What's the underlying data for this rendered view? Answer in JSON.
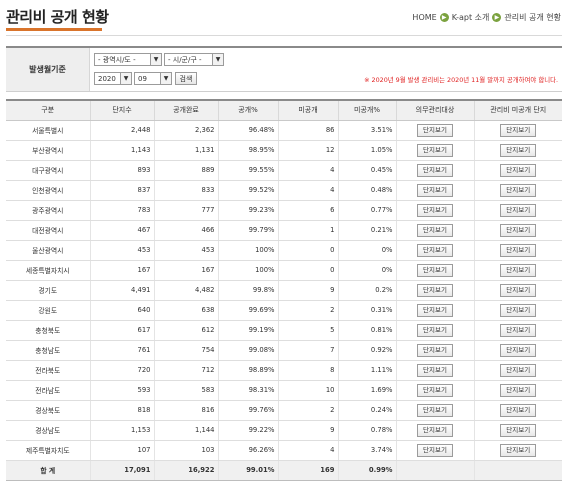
{
  "page": {
    "title": "관리비 공개 현황",
    "breadcrumb": [
      "HOME",
      "K-apt 소개",
      "관리비 공개 현황"
    ]
  },
  "filter": {
    "label": "발생월기준",
    "region_select": "- 광역시/도 -",
    "district_select": "- 시/군/구 -",
    "year_select": "2020",
    "month_select": "09",
    "search_button": "검색",
    "notice": "※ 2020년 9월 발생 관리비는 2020년 11월 말까지 공개하여야 합니다."
  },
  "table": {
    "headers": [
      "구분",
      "단지수",
      "공개완료",
      "공개%",
      "미공개",
      "미공개%",
      "의무관리대상",
      "관리비 미공개 단지"
    ],
    "button_label": "단지보기",
    "rows": [
      {
        "region": "서울특별시",
        "complexes": "2,448",
        "disclosed": "2,362",
        "disclosed_pct": "96.48%",
        "undisclosed": "86",
        "undisclosed_pct": "3.51%"
      },
      {
        "region": "부산광역시",
        "complexes": "1,143",
        "disclosed": "1,131",
        "disclosed_pct": "98.95%",
        "undisclosed": "12",
        "undisclosed_pct": "1.05%"
      },
      {
        "region": "대구광역시",
        "complexes": "893",
        "disclosed": "889",
        "disclosed_pct": "99.55%",
        "undisclosed": "4",
        "undisclosed_pct": "0.45%"
      },
      {
        "region": "인천광역시",
        "complexes": "837",
        "disclosed": "833",
        "disclosed_pct": "99.52%",
        "undisclosed": "4",
        "undisclosed_pct": "0.48%"
      },
      {
        "region": "광주광역시",
        "complexes": "783",
        "disclosed": "777",
        "disclosed_pct": "99.23%",
        "undisclosed": "6",
        "undisclosed_pct": "0.77%"
      },
      {
        "region": "대전광역시",
        "complexes": "467",
        "disclosed": "466",
        "disclosed_pct": "99.79%",
        "undisclosed": "1",
        "undisclosed_pct": "0.21%"
      },
      {
        "region": "울산광역시",
        "complexes": "453",
        "disclosed": "453",
        "disclosed_pct": "100%",
        "undisclosed": "0",
        "undisclosed_pct": "0%"
      },
      {
        "region": "세종특별자치시",
        "complexes": "167",
        "disclosed": "167",
        "disclosed_pct": "100%",
        "undisclosed": "0",
        "undisclosed_pct": "0%"
      },
      {
        "region": "경기도",
        "complexes": "4,491",
        "disclosed": "4,482",
        "disclosed_pct": "99.8%",
        "undisclosed": "9",
        "undisclosed_pct": "0.2%"
      },
      {
        "region": "강원도",
        "complexes": "640",
        "disclosed": "638",
        "disclosed_pct": "99.69%",
        "undisclosed": "2",
        "undisclosed_pct": "0.31%"
      },
      {
        "region": "충청북도",
        "complexes": "617",
        "disclosed": "612",
        "disclosed_pct": "99.19%",
        "undisclosed": "5",
        "undisclosed_pct": "0.81%"
      },
      {
        "region": "충청남도",
        "complexes": "761",
        "disclosed": "754",
        "disclosed_pct": "99.08%",
        "undisclosed": "7",
        "undisclosed_pct": "0.92%"
      },
      {
        "region": "전라북도",
        "complexes": "720",
        "disclosed": "712",
        "disclosed_pct": "98.89%",
        "undisclosed": "8",
        "undisclosed_pct": "1.11%"
      },
      {
        "region": "전라남도",
        "complexes": "593",
        "disclosed": "583",
        "disclosed_pct": "98.31%",
        "undisclosed": "10",
        "undisclosed_pct": "1.69%"
      },
      {
        "region": "경상북도",
        "complexes": "818",
        "disclosed": "816",
        "disclosed_pct": "99.76%",
        "undisclosed": "2",
        "undisclosed_pct": "0.24%"
      },
      {
        "region": "경상남도",
        "complexes": "1,153",
        "disclosed": "1,144",
        "disclosed_pct": "99.22%",
        "undisclosed": "9",
        "undisclosed_pct": "0.78%"
      },
      {
        "region": "제주특별자치도",
        "complexes": "107",
        "disclosed": "103",
        "disclosed_pct": "96.26%",
        "undisclosed": "4",
        "undisclosed_pct": "3.74%"
      }
    ],
    "total": {
      "label": "합 계",
      "complexes": "17,091",
      "disclosed": "16,922",
      "disclosed_pct": "99.01%",
      "undisclosed": "169",
      "undisclosed_pct": "0.99%"
    }
  },
  "colors": {
    "accent": "#d9742b",
    "breadcrumb_arrow": "#7ba23f",
    "notice": "#e02020"
  },
  "icons": {
    "breadcrumb_separator": "arrow-right-circle-icon",
    "select_dropdown": "chevron-down-icon"
  }
}
